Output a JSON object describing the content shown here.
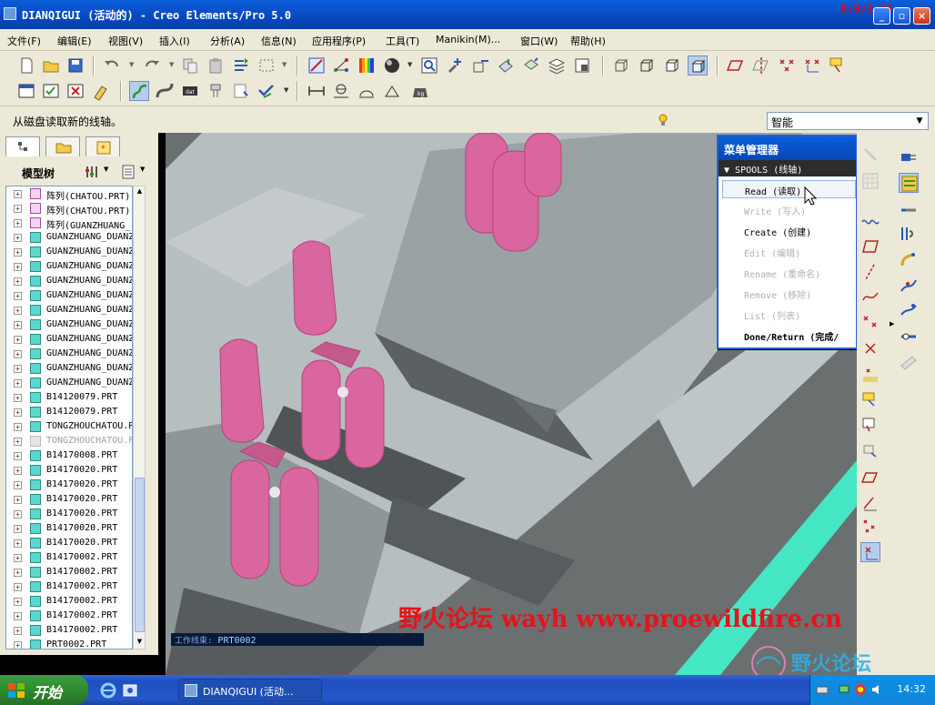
{
  "window": {
    "title": "DIANQIGUI (活动的) - Creo Elements/Pro 5.0",
    "recording_timer": "0:9/3:45"
  },
  "menu": {
    "items": [
      "文件(F)",
      "编辑(E)",
      "视图(V)",
      "插入(I)",
      "分析(A)",
      "信息(N)",
      "应用程序(P)",
      "工具(T)",
      "Manikin(M)...",
      "窗口(W)",
      "帮助(H)"
    ]
  },
  "message_bar": {
    "message": "从磁盘读取新的线轴。",
    "filter_value": "智能"
  },
  "model_tree": {
    "title": "模型树",
    "rows": [
      {
        "label": "阵列(CHATOU.PRT)",
        "icon": "pattern",
        "dim": false
      },
      {
        "label": "阵列(CHATOU.PRT)",
        "icon": "pattern",
        "dim": false
      },
      {
        "label": "阵列(GUANZHUANG_",
        "icon": "pattern",
        "dim": false
      },
      {
        "label": "GUANZHUANG_DUANZ",
        "icon": "part",
        "dim": false
      },
      {
        "label": "GUANZHUANG_DUANZ",
        "icon": "part",
        "dim": false
      },
      {
        "label": "GUANZHUANG_DUANZ",
        "icon": "part",
        "dim": false
      },
      {
        "label": "GUANZHUANG_DUANZ",
        "icon": "part",
        "dim": false
      },
      {
        "label": "GUANZHUANG_DUANZ",
        "icon": "part",
        "dim": false
      },
      {
        "label": "GUANZHUANG_DUANZ",
        "icon": "part",
        "dim": false
      },
      {
        "label": "GUANZHUANG_DUANZ",
        "icon": "part",
        "dim": false
      },
      {
        "label": "GUANZHUANG_DUANZ",
        "icon": "part",
        "dim": false
      },
      {
        "label": "GUANZHUANG_DUANZ",
        "icon": "part",
        "dim": false
      },
      {
        "label": "GUANZHUANG_DUANZ",
        "icon": "part",
        "dim": false
      },
      {
        "label": "GUANZHUANG_DUANZ",
        "icon": "part",
        "dim": false
      },
      {
        "label": "B14120079.PRT",
        "icon": "part",
        "dim": false
      },
      {
        "label": "B14120079.PRT",
        "icon": "part",
        "dim": false
      },
      {
        "label": "TONGZHOUCHATOU.P",
        "icon": "part",
        "dim": false
      },
      {
        "label": "TONGZHOUCHATOU.P",
        "icon": "ghost",
        "dim": true
      },
      {
        "label": "B14170008.PRT",
        "icon": "part",
        "dim": false
      },
      {
        "label": "B14170020.PRT",
        "icon": "part",
        "dim": false
      },
      {
        "label": "B14170020.PRT",
        "icon": "part",
        "dim": false
      },
      {
        "label": "B14170020.PRT",
        "icon": "part",
        "dim": false
      },
      {
        "label": "B14170020.PRT",
        "icon": "part",
        "dim": false
      },
      {
        "label": "B14170020.PRT",
        "icon": "part",
        "dim": false
      },
      {
        "label": "B14170020.PRT",
        "icon": "part",
        "dim": false
      },
      {
        "label": "B14170002.PRT",
        "icon": "part",
        "dim": false
      },
      {
        "label": "B14170002.PRT",
        "icon": "part",
        "dim": false
      },
      {
        "label": "B14170002.PRT",
        "icon": "part",
        "dim": false
      },
      {
        "label": "B14170002.PRT",
        "icon": "part",
        "dim": false
      },
      {
        "label": "B14170002.PRT",
        "icon": "part",
        "dim": false
      },
      {
        "label": "B14170002.PRT",
        "icon": "part",
        "dim": false
      },
      {
        "label": "PRT0002.PRT",
        "icon": "part-active",
        "dim": false
      }
    ]
  },
  "menu_manager": {
    "title": "菜单管理器",
    "section": "SPOOLS (线轴)",
    "items": [
      {
        "label": "Read (读取)",
        "state": "hilite"
      },
      {
        "label": "Write (写入)",
        "state": "disabled"
      },
      {
        "label": "Create (创建)",
        "state": "normal"
      },
      {
        "label": "Edit (编辑)",
        "state": "disabled"
      },
      {
        "label": "Rename (重命名)",
        "state": "disabled"
      },
      {
        "label": "Remove (移除)",
        "state": "disabled"
      },
      {
        "label": "List (列表)",
        "state": "disabled"
      },
      {
        "label": "Done/Return (完成/",
        "state": "bold"
      }
    ]
  },
  "work_layer": {
    "label": "工作线束:",
    "value": "PRT0002"
  },
  "watermark": {
    "text": "野火论坛 wayh www.proewildfire.cn",
    "logo_text": "野火论坛"
  },
  "taskbar": {
    "start_label": "开始",
    "task_label": "DIANQIGUI (活动...",
    "clock": "14:32"
  },
  "colors": {
    "title_blue": "#0a5ed8",
    "ui_face": "#ece9d8",
    "cable_pink": "#d9669e",
    "floor_cyan": "#45e6c4",
    "watermark_red": "#e8121a"
  }
}
